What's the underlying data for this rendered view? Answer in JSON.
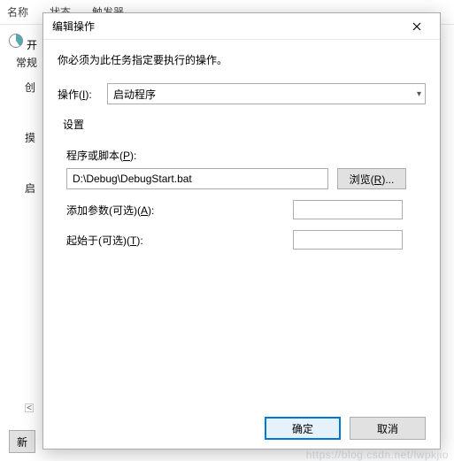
{
  "bg": {
    "col1": "名称",
    "col2": "状态",
    "col3": "触发器",
    "app_icon_title": "开",
    "tab": "常规",
    "left_items": [
      "创",
      "摸",
      "启"
    ],
    "scroll_left": "<",
    "new_button": "新"
  },
  "dialog": {
    "title": "编辑操作",
    "instruction": "你必须为此任务指定要执行的操作。",
    "action_label_pre": "操作(",
    "action_label_key": "I",
    "action_label_post": "):",
    "action_value": "启动程序",
    "settings_legend": "设置",
    "script_label_pre": "程序或脚本(",
    "script_label_key": "P",
    "script_label_post": "):",
    "script_value": "D:\\Debug\\DebugStart.bat",
    "browse_pre": "浏览(",
    "browse_key": "R",
    "browse_post": ")...",
    "args_label_pre": "添加参数(可选)(",
    "args_label_key": "A",
    "args_label_post": "):",
    "args_value": "",
    "startin_label_pre": "起始于(可选)(",
    "startin_label_key": "T",
    "startin_label_post": "):",
    "startin_value": "",
    "ok": "确定",
    "cancel": "取消"
  },
  "watermark": "https://blog.csdn.net/lwpkjio"
}
